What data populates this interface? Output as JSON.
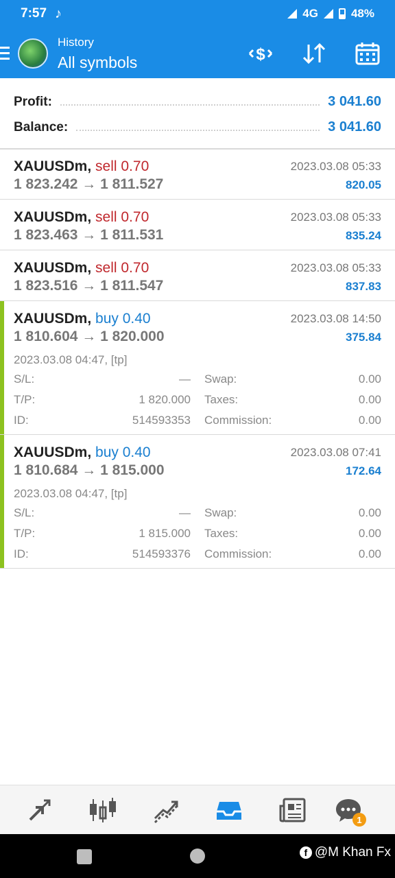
{
  "status_bar": {
    "time": "7:57",
    "network": "4G",
    "battery": "48%"
  },
  "header": {
    "subtitle": "History",
    "title": "All symbols"
  },
  "summary": {
    "profit_label": "Profit:",
    "profit_value": "3 041.60",
    "balance_label": "Balance:",
    "balance_value": "3 041.60"
  },
  "deals": [
    {
      "symbol": "XAUUSDm,",
      "side": "sell 0.70",
      "side_type": "sell",
      "prices": "1 823.242 → 1 811.527",
      "time": "2023.03.08 05:33",
      "profit": "820.05"
    },
    {
      "symbol": "XAUUSDm,",
      "side": "sell 0.70",
      "side_type": "sell",
      "prices": "1 823.463 → 1 811.531",
      "time": "2023.03.08 05:33",
      "profit": "835.24"
    },
    {
      "symbol": "XAUUSDm,",
      "side": "sell 0.70",
      "side_type": "sell",
      "prices": "1 823.516 → 1 811.547",
      "time": "2023.03.08 05:33",
      "profit": "837.83"
    },
    {
      "symbol": "XAUUSDm,",
      "side": "buy 0.40",
      "side_type": "buy",
      "prices": "1 810.604 → 1 820.000",
      "time": "2023.03.08 14:50",
      "profit": "375.84",
      "opened": "2023.03.08 04:47, [tp]",
      "sl_label": "S/L:",
      "sl_value": "—",
      "swap_label": "Swap:",
      "swap_value": "0.00",
      "tp_label": "T/P:",
      "tp_value": "1 820.000",
      "taxes_label": "Taxes:",
      "taxes_value": "0.00",
      "id_label": "ID:",
      "id_value": "514593353",
      "commission_label": "Commission:",
      "commission_value": "0.00"
    },
    {
      "symbol": "XAUUSDm,",
      "side": "buy 0.40",
      "side_type": "buy",
      "prices": "1 810.684 → 1 815.000",
      "time": "2023.03.08 07:41",
      "profit": "172.64",
      "opened": "2023.03.08 04:47, [tp]",
      "sl_label": "S/L:",
      "sl_value": "—",
      "swap_label": "Swap:",
      "swap_value": "0.00",
      "tp_label": "T/P:",
      "tp_value": "1 815.000",
      "taxes_label": "Taxes:",
      "taxes_value": "0.00",
      "id_label": "ID:",
      "id_value": "514593376",
      "commission_label": "Commission:",
      "commission_value": "0.00"
    }
  ],
  "bottom_nav": {
    "items": [
      "quotes-icon",
      "chart-icon",
      "trade-icon",
      "history-icon",
      "news-icon",
      "chat-icon"
    ],
    "active": "history-icon",
    "chat_badge": "1"
  },
  "watermark": "@M Khan Fx",
  "colors": {
    "accent": "#1a8ce6",
    "sell": "#c0282d",
    "buy": "#1a7fd0",
    "active_bar": "#8dc21f",
    "badge": "#f39c12"
  }
}
